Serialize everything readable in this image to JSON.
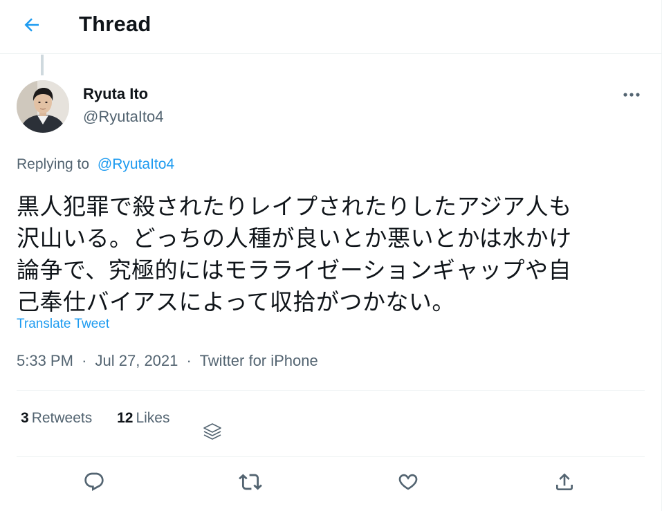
{
  "header": {
    "title": "Thread",
    "back_icon": "arrow-left-icon"
  },
  "author": {
    "name": "Ryuta Ito",
    "handle": "@RyutaIto4",
    "avatar_icon": "profile-photo"
  },
  "reply": {
    "prefix": "Replying to",
    "handle": "@RyutaIto4"
  },
  "tweet": {
    "lines": [
      "黒人犯罪で殺されたりレイプされたりしたアジア人も",
      "沢山いる。どっちの人種が良いとか悪いとかは水かけ",
      "論争で、究極的にはモラライゼーションギャップや自",
      "己奉仕バイアスによって収拾がつかない。"
    ],
    "translate_label": "Translate Tweet"
  },
  "meta": {
    "time": "5:33 PM",
    "separator": "·",
    "date": "Jul 27, 2021",
    "source": "Twitter for iPhone"
  },
  "stats": {
    "retweets_count": "3",
    "retweets_label": "Retweets",
    "likes_count": "12",
    "likes_label": "Likes"
  },
  "actions": [
    "reply-icon",
    "retweet-icon",
    "like-icon",
    "share-icon"
  ],
  "colors": {
    "accent": "#1d9bf0",
    "text": "#0f1419",
    "secondary": "#536471",
    "border": "#eff3f4"
  }
}
